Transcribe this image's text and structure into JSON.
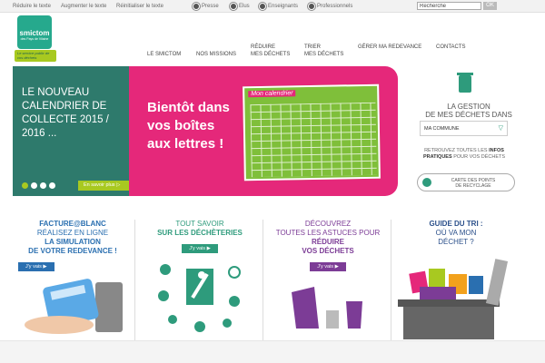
{
  "accessibility": [
    "Réduire le texte",
    "Augmenter le texte",
    "Réinitialiser le texte"
  ],
  "audiences": [
    "Presse",
    "Elus",
    "Enseignants",
    "Professionnels"
  ],
  "search": {
    "value": "Recherche",
    "button": "OK"
  },
  "logo": {
    "name": "smictom",
    "sub": "des Pays de Vilaine",
    "tagline": "Le service public de vos déchets"
  },
  "nav": {
    "le_smictom": "LE SMICTOM",
    "nos_missions": "NOS MISSIONS",
    "reduire_1": "RÉDUIRE",
    "reduire_2": "MES DÉCHETS",
    "trier_1": "TRIER",
    "trier_2": "MES DÉCHETS",
    "redevance": "GÉRER MA REDEVANCE",
    "contacts": "CONTACTS"
  },
  "slider": {
    "title": "LE NOUVEAU CALENDRIER DE COLLECTE 2015 / 2016 ...",
    "more": "En savoir plus",
    "headline_1": "Bientôt dans",
    "headline_2": "vos boîtes",
    "headline_3": "aux lettres !",
    "calendar_title": "Mon calendrier"
  },
  "commune": {
    "line1": "LA GESTION",
    "line2": "DE MES DÉCHETS DANS",
    "select": "MA COMMUNE",
    "retro_1": "RETROUVEZ TOUTES LES",
    "retro_infos": "INFOS",
    "retro_2": "PRATIQUES",
    "retro_3": "POUR VOS DÉCHETS",
    "carte_1": "CARTE DES POINTS",
    "carte_2": "DE RECYCLAGE"
  },
  "columns": [
    {
      "l1": "FACTURE@BLANC",
      "l2": "RÉALISEZ EN LIGNE",
      "l3": "LA SIMULATION",
      "l4": "DE VOTRE REDEVANCE !",
      "btn": "J'y vais"
    },
    {
      "l1": "TOUT SAVOIR",
      "l2": "SUR LES DÉCHÈTERIES",
      "btn": "J'y vais"
    },
    {
      "l1": "DÉCOUVREZ",
      "l2": "TOUTES LES ASTUCES POUR",
      "l3": "RÉDUIRE",
      "l4": "VOS DÉCHETS",
      "btn": "J'y vais"
    },
    {
      "l1": "GUIDE DU TRI :",
      "l2": "OÙ VA MON",
      "l3": "DÉCHET ?"
    }
  ],
  "colors": {
    "teal": "#2e7a6c",
    "green": "#a8c920",
    "pink": "#e5287a",
    "purple": "#7c3c96",
    "blue": "#2a6fb0"
  }
}
